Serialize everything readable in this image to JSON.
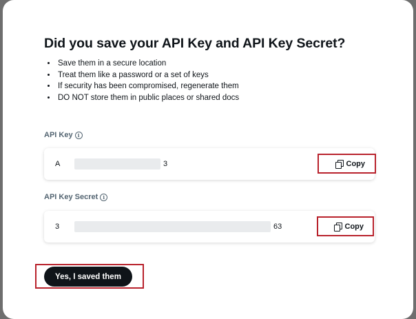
{
  "dialog": {
    "title": "Did you save your API Key and API Key Secret?",
    "bullets": [
      "Save them in a secure location",
      "Treat them like a password or a set of keys",
      "If security has been compromised, regenerate them",
      "DO NOT store them in public places or shared docs"
    ]
  },
  "api_key": {
    "label": "API Key",
    "info_icon": "info-circle-icon",
    "value_start": "A",
    "value_end": "3",
    "copy_label": "Copy",
    "copy_icon": "copy-icon"
  },
  "api_key_secret": {
    "label": "API Key Secret",
    "info_icon": "info-circle-icon",
    "value_start": "3",
    "value_end": "63",
    "copy_label": "Copy",
    "copy_icon": "copy-icon"
  },
  "footer": {
    "confirm_label": "Yes, I saved them"
  },
  "colors": {
    "primary_button": "#0f1419",
    "highlight": "#b8212b",
    "muted_text": "#536471",
    "redaction": "#e9ebed"
  }
}
